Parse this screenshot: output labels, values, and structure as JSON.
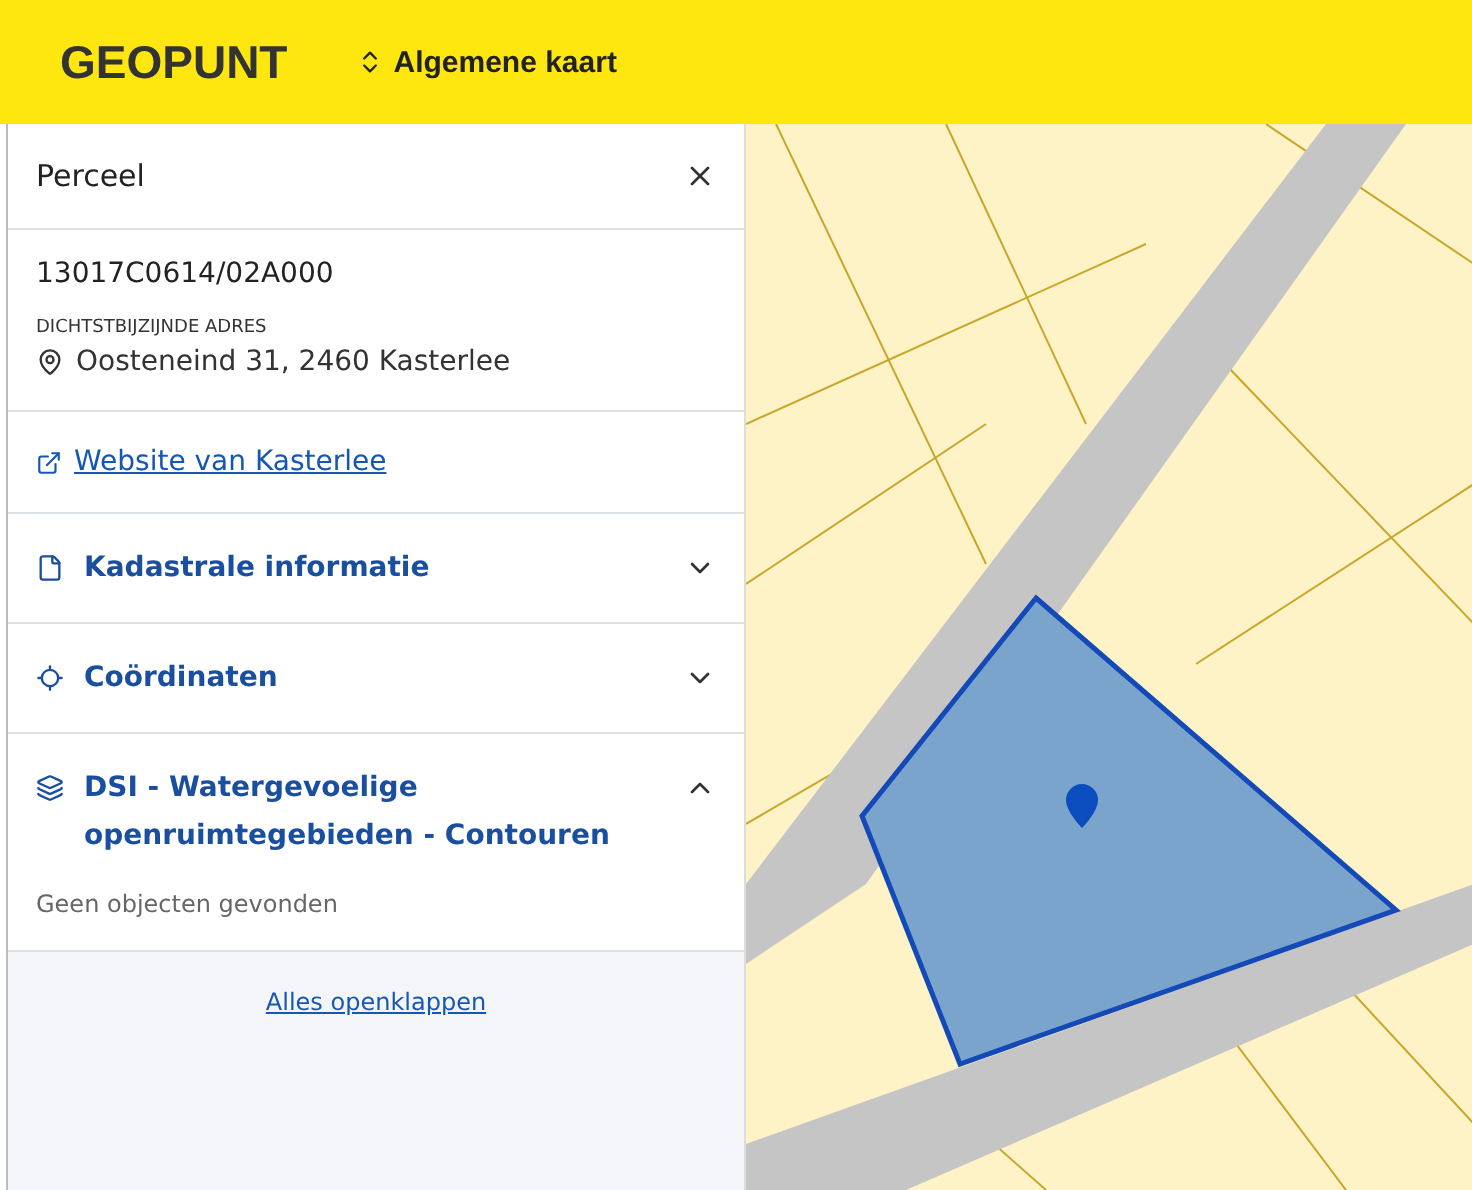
{
  "header": {
    "logo": "GEOPUNT",
    "map_switch": {
      "label": "Algemene kaart"
    }
  },
  "panel": {
    "title": "Perceel",
    "parcel_id": "13017C0614/02A000",
    "address_label": "DICHTSTBIJZIJNDE ADRES",
    "address": "Oosteneind 31, 2460 Kasterlee",
    "link": "Website van Kasterlee",
    "sections": [
      {
        "kind": "document",
        "title": "Kadastrale informatie",
        "expanded": false
      },
      {
        "kind": "target",
        "title": "Coördinaten",
        "expanded": false
      },
      {
        "kind": "layers",
        "title": "DSI - Watergevoelige openruimtegebieden - Contouren",
        "expanded": true,
        "body": "Geen objecten gevonden"
      }
    ],
    "footer_link": "Alles openklappen"
  }
}
